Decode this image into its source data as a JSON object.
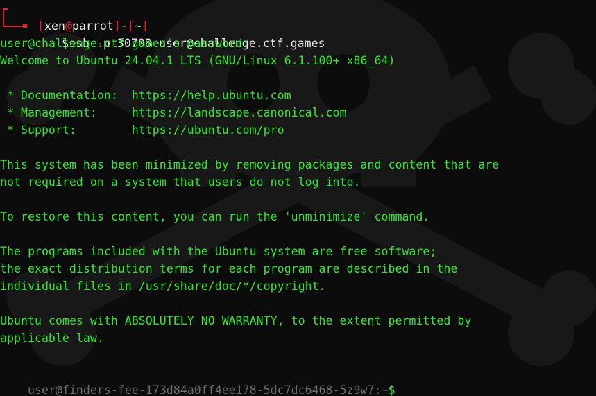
{
  "colors": {
    "prompt_bracket": "#e0232c",
    "prompt_text": "#e8e8e8",
    "output_text": "#2ee82e",
    "faint_prompt": "#6e6e6e",
    "background": "#0c0c0c"
  },
  "prompt": {
    "open_bracket": "[",
    "user": "xen",
    "at": "@",
    "host": "parrot",
    "close_bracket": "]",
    "dash": "-",
    "dir_open": "[",
    "dir": "~",
    "dir_close": "]",
    "dollar": "$",
    "command": "ssh -p 30703 user@challenge.ctf.games"
  },
  "output_lines": [
    "user@challenge.ctf.games's password:",
    "Welcome to Ubuntu 24.04.1 LTS (GNU/Linux 6.1.100+ x86_64)",
    "",
    " * Documentation:  https://help.ubuntu.com",
    " * Management:     https://landscape.canonical.com",
    " * Support:        https://ubuntu.com/pro",
    "",
    "This system has been minimized by removing packages and content that are",
    "not required on a system that users do not log into.",
    "",
    "To restore this content, you can run the 'unminimize' command.",
    "",
    "The programs included with the Ubuntu system are free software;",
    "the exact distribution terms for each program are described in the",
    "individual files in /usr/share/doc/*/copyright.",
    "",
    "Ubuntu comes with ABSOLUTELY NO WARRANTY, to the extent permitted by",
    "applicable law.",
    ""
  ],
  "remote_prompt": {
    "user_host": "user@finders-fee-173d84a0ff4ee178-5dc7dc6468-5z9w7",
    "sep": ":",
    "path": "~",
    "dollar": "$"
  }
}
